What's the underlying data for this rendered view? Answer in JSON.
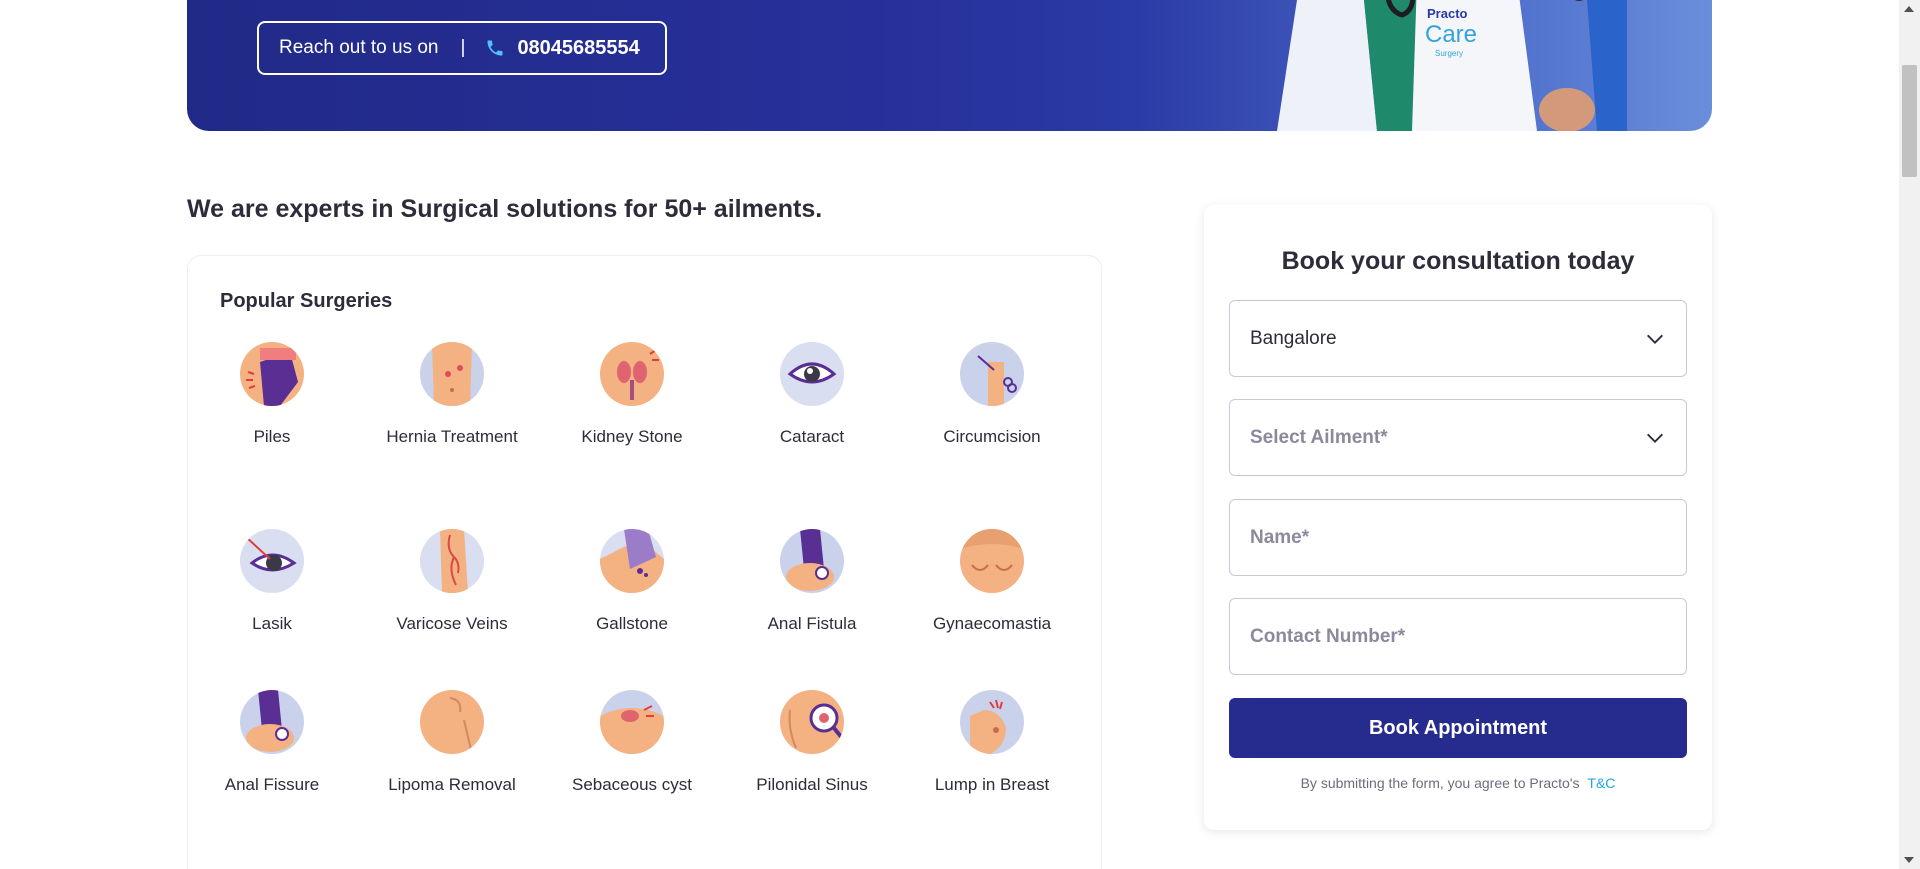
{
  "hero": {
    "reach_label": "Reach out to us on",
    "separator": "|",
    "phone_icon": "phone-icon",
    "phone_number": "08045685554",
    "badge_line1": "Practo",
    "badge_line2": "Care",
    "badge_line3": "Surgery",
    "colors": {
      "start": "#212a87",
      "end": "#6b8edb"
    }
  },
  "section": {
    "heading": "We are experts in Surgical solutions for 50+ ailments."
  },
  "popular": {
    "title": "Popular Surgeries",
    "items": [
      {
        "label": "Piles",
        "icon": "piles-icon"
      },
      {
        "label": "Hernia Treatment",
        "icon": "hernia-icon"
      },
      {
        "label": "Kidney Stone",
        "icon": "kidney-stone-icon"
      },
      {
        "label": "Cataract",
        "icon": "cataract-icon"
      },
      {
        "label": "Circumcision",
        "icon": "circumcision-icon"
      },
      {
        "label": "Lasik",
        "icon": "lasik-icon"
      },
      {
        "label": "Varicose Veins",
        "icon": "varicose-veins-icon"
      },
      {
        "label": "Gallstone",
        "icon": "gallstone-icon"
      },
      {
        "label": "Anal Fistula",
        "icon": "anal-fistula-icon"
      },
      {
        "label": "Gynaecomastia",
        "icon": "gynaecomastia-icon"
      },
      {
        "label": "Anal Fissure",
        "icon": "anal-fissure-icon"
      },
      {
        "label": "Lipoma Removal",
        "icon": "lipoma-icon"
      },
      {
        "label": "Sebaceous cyst",
        "icon": "sebaceous-cyst-icon"
      },
      {
        "label": "Pilonidal Sinus",
        "icon": "pilonidal-sinus-icon"
      },
      {
        "label": "Lump in Breast",
        "icon": "lump-in-breast-icon"
      }
    ]
  },
  "form": {
    "title": "Book your consultation today",
    "city_value": "Bangalore",
    "ailment_placeholder": "Select Ailment*",
    "name_placeholder": "Name*",
    "contact_placeholder": "Contact Number*",
    "button_label": "Book Appointment",
    "terms_text": "By submitting the form, you agree to Practo's",
    "terms_link": "T&C",
    "colors": {
      "button": "#262c8e",
      "link": "#1ea6e0"
    }
  }
}
